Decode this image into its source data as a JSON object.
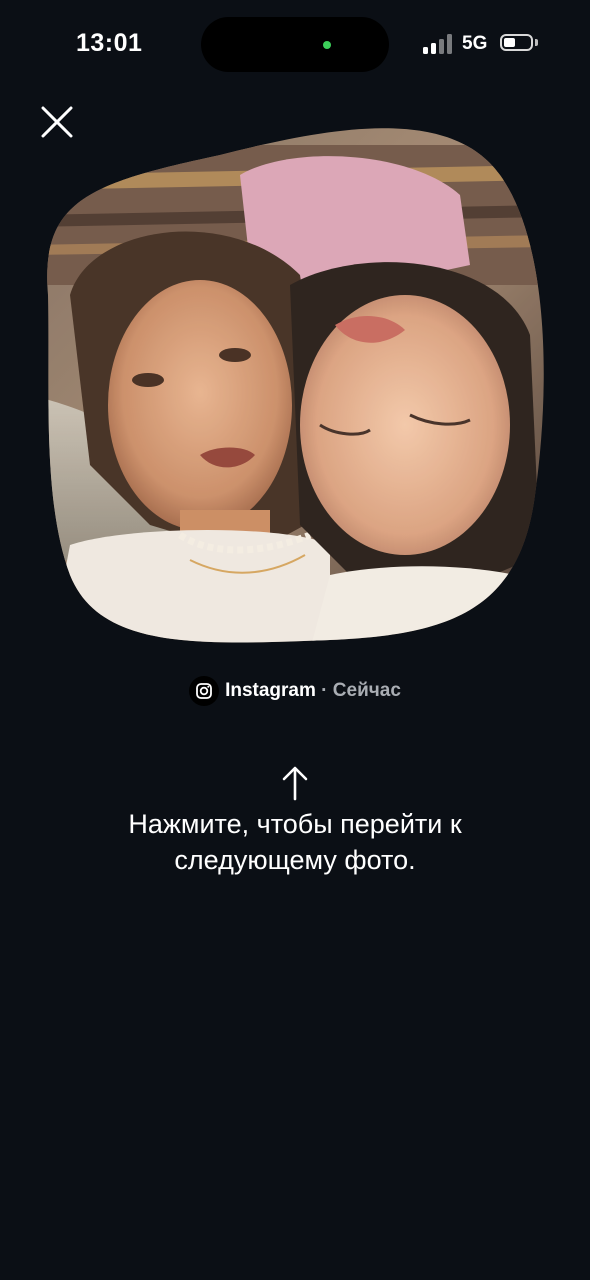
{
  "status_bar": {
    "time": "13:01",
    "network": "5G",
    "battery_level": 0.45,
    "signal_bars_active": 2
  },
  "viewer": {
    "close_icon": "close-icon",
    "photo_description_icon": "photo"
  },
  "source": {
    "app_icon": "instagram-icon",
    "app_name": "Instagram",
    "separator": "·",
    "time": "Сейчас"
  },
  "hint": {
    "arrow_icon": "arrow-up-icon",
    "line1": "Нажмите, чтобы перейти к",
    "line2": "следующему фото."
  },
  "colors": {
    "background": "#0b0f15",
    "accent_dot": "#3ccf5a",
    "muted_text": "#a9adb3"
  }
}
